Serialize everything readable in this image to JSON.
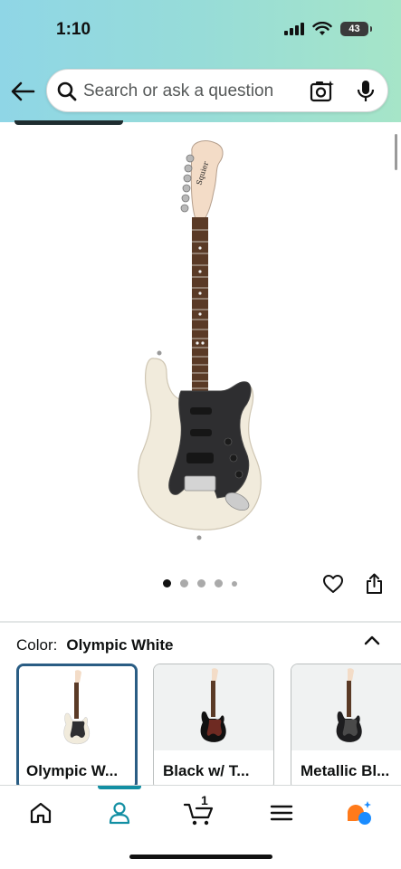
{
  "status_bar": {
    "time": "1:10",
    "battery": "43"
  },
  "search": {
    "placeholder": "Search or ask a question"
  },
  "product": {
    "carousel": {
      "total_images": 5,
      "active_index": 0
    }
  },
  "color_selector": {
    "label": "Color:",
    "selected": "Olympic White",
    "options": [
      {
        "name": "Olympic W...",
        "body_color": "#f1ebdc",
        "guard_color": "#2a2a2a"
      },
      {
        "name": "Black w/ T...",
        "body_color": "#111111",
        "guard_color": "#6e2a22"
      },
      {
        "name": "Metallic Bl...",
        "body_color": "#1d1d1f",
        "guard_color": "#4a4a4a"
      }
    ]
  },
  "bottom_nav": {
    "items": [
      "home-icon",
      "account-icon",
      "cart-icon",
      "menu-icon",
      "rufus-icon"
    ],
    "active": "account-icon",
    "cart_count": "1"
  },
  "colors": {
    "accent": "#128fa3",
    "selected_border": "#2a5d84",
    "rufus_orange": "#ff7a1a",
    "rufus_blue": "#1a8cff"
  }
}
